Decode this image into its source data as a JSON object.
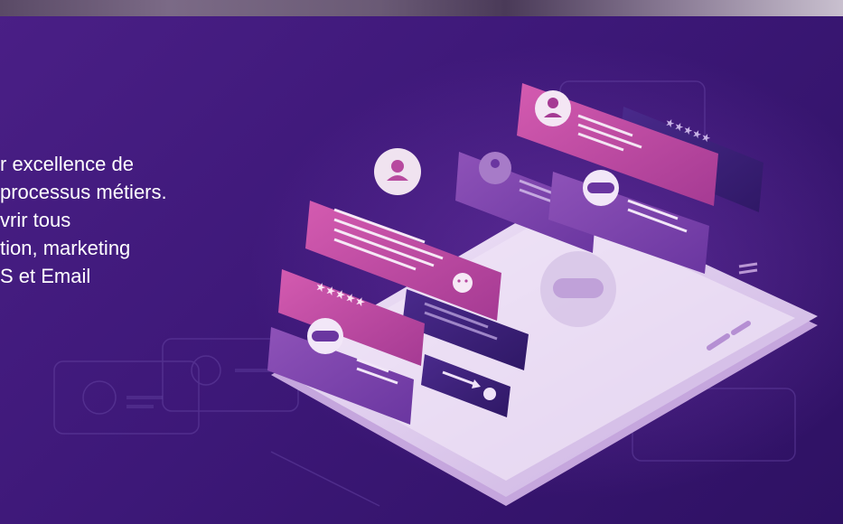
{
  "hero": {
    "lines": [
      "r excellence de",
      "processus métiers.",
      "vrir tous",
      "tion, marketing",
      "S et Email"
    ]
  },
  "illustration": {
    "subject": "smartphone-with-floating-chat-bubbles",
    "colors": {
      "background": "#3d1878",
      "phone_body": "#e9dcf2",
      "bubble_magenta": "#c0479c",
      "bubble_purple": "#7a3fa8",
      "bubble_dark": "#3b1f78"
    }
  }
}
